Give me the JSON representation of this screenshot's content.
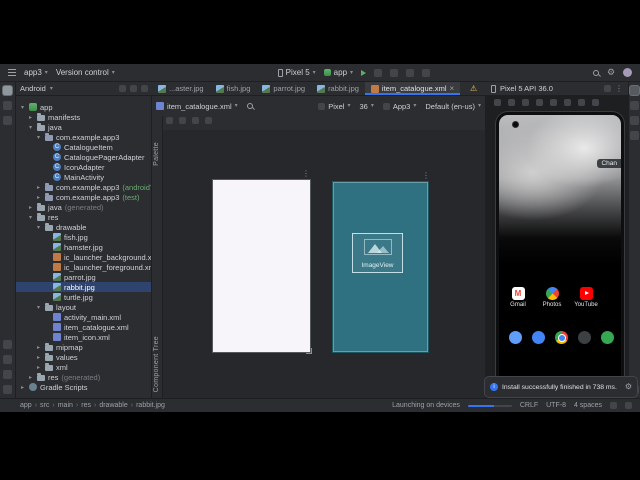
{
  "icons": {
    "chevron_down": "▾",
    "chevron_right": "▸",
    "breadcrumb_sep": "›",
    "more_vertical": "⋮",
    "warning": "⚠",
    "gear": "⚙",
    "close": "×"
  },
  "titlebar": {
    "project_name": "app3",
    "version_control": "Version control",
    "device_selector": "Pixel 5",
    "run_config": "app"
  },
  "project_panel": {
    "mode": "Android",
    "tree": [
      {
        "label": "app",
        "level": 0,
        "icon": "app",
        "chevron": "d"
      },
      {
        "label": "manifests",
        "level": 1,
        "icon": "folder",
        "chevron": "r"
      },
      {
        "label": "java",
        "level": 1,
        "icon": "folder",
        "chevron": "d"
      },
      {
        "label": "com.example.app3",
        "level": 2,
        "icon": "package",
        "chevron": "d"
      },
      {
        "label": "CatalogueItem",
        "level": 3,
        "icon": "class",
        "chevron": ""
      },
      {
        "label": "CataloguePagerAdapter",
        "level": 3,
        "icon": "class",
        "chevron": ""
      },
      {
        "label": "IconAdapter",
        "level": 3,
        "icon": "class",
        "chevron": ""
      },
      {
        "label": "MainActivity",
        "level": 3,
        "icon": "class",
        "chevron": ""
      },
      {
        "label": "com.example.app3",
        "suffix": "(androidTest)",
        "suffix_style": "green",
        "level": 2,
        "icon": "package",
        "chevron": "r"
      },
      {
        "label": "com.example.app3",
        "suffix": "(test)",
        "suffix_style": "green",
        "level": 2,
        "icon": "package",
        "chevron": "r"
      },
      {
        "label": "java",
        "suffix": "(generated)",
        "suffix_style": "gray",
        "level": 1,
        "icon": "folder",
        "chevron": "r"
      },
      {
        "label": "res",
        "level": 1,
        "icon": "folder",
        "chevron": "d"
      },
      {
        "label": "drawable",
        "level": 2,
        "icon": "folder",
        "chevron": "d"
      },
      {
        "label": "fish.jpg",
        "level": 3,
        "icon": "image",
        "chevron": ""
      },
      {
        "label": "hamster.jpg",
        "level": 3,
        "icon": "image",
        "chevron": ""
      },
      {
        "label": "ic_launcher_background.xml",
        "level": 3,
        "icon": "xml",
        "chevron": ""
      },
      {
        "label": "ic_launcher_foreground.xml",
        "level": 3,
        "icon": "xml",
        "chevron": ""
      },
      {
        "label": "parrot.jpg",
        "level": 3,
        "icon": "image",
        "chevron": ""
      },
      {
        "label": "rabbit.jpg",
        "level": 3,
        "icon": "image",
        "chevron": "",
        "selected": true
      },
      {
        "label": "turtle.jpg",
        "level": 3,
        "icon": "image",
        "chevron": ""
      },
      {
        "label": "layout",
        "level": 2,
        "icon": "folder",
        "chevron": "d"
      },
      {
        "label": "activity_main.xml",
        "level": 3,
        "icon": "layoutxml",
        "chevron": ""
      },
      {
        "label": "item_catalogue.xml",
        "level": 3,
        "icon": "layoutxml",
        "chevron": ""
      },
      {
        "label": "item_icon.xml",
        "level": 3,
        "icon": "layoutxml",
        "chevron": ""
      },
      {
        "label": "mipmap",
        "level": 2,
        "icon": "folder",
        "chevron": "r"
      },
      {
        "label": "values",
        "level": 2,
        "icon": "folder",
        "chevron": "r"
      },
      {
        "label": "xml",
        "level": 2,
        "icon": "folder",
        "chevron": "r"
      },
      {
        "label": "res",
        "suffix": "(generated)",
        "suffix_style": "gray",
        "level": 1,
        "icon": "folder",
        "chevron": "r"
      },
      {
        "label": "Gradle Scripts",
        "level": 0,
        "icon": "gradle",
        "chevron": "r"
      }
    ]
  },
  "editor": {
    "tabs": [
      {
        "label": "...aster.jpg",
        "icon": "image",
        "active": false,
        "closable": false
      },
      {
        "label": "fish.jpg",
        "icon": "image",
        "active": false,
        "closable": false
      },
      {
        "label": "parrot.jpg",
        "icon": "image",
        "active": false,
        "closable": false
      },
      {
        "label": "rabbit.jpg",
        "icon": "image",
        "active": false,
        "closable": false
      },
      {
        "label": "item_catalogue.xml",
        "icon": "xml",
        "active": true,
        "closable": true
      }
    ],
    "design_toolbar": {
      "file_chip": "item_catalogue.xml",
      "device": "Pixel",
      "api": "36",
      "theme": "App3",
      "locale": "Default (en-us)"
    },
    "palette_label": "Palette",
    "component_tree_label": "Component Tree",
    "blueprint": {
      "imageview_label": "ImageView"
    }
  },
  "running_devices": {
    "title": "Pixel 5 API 36.0",
    "notification_chip": "Chan",
    "favorites": [
      {
        "name": "gmail",
        "label": "Gmail"
      },
      {
        "name": "photos",
        "label": "Photos"
      },
      {
        "name": "youtube",
        "label": "YouTube"
      }
    ],
    "dock": [
      {
        "name": "phone",
        "color": "#5f9df7"
      },
      {
        "name": "messages",
        "color": "#4285f4"
      },
      {
        "name": "chrome",
        "color": "#ffffff"
      },
      {
        "name": "camera",
        "color": "#3c4043"
      },
      {
        "name": "maps",
        "color": "#34a853"
      }
    ]
  },
  "toast": {
    "message": "Install successfully finished in 738 ms."
  },
  "statusbar": {
    "breadcrumbs": [
      "app",
      "src",
      "main",
      "res",
      "drawable",
      "rabbit.jpg"
    ],
    "progress_label": "Launching on devices",
    "right": [
      "CRLF",
      "UTF-8",
      "4 spaces"
    ]
  }
}
